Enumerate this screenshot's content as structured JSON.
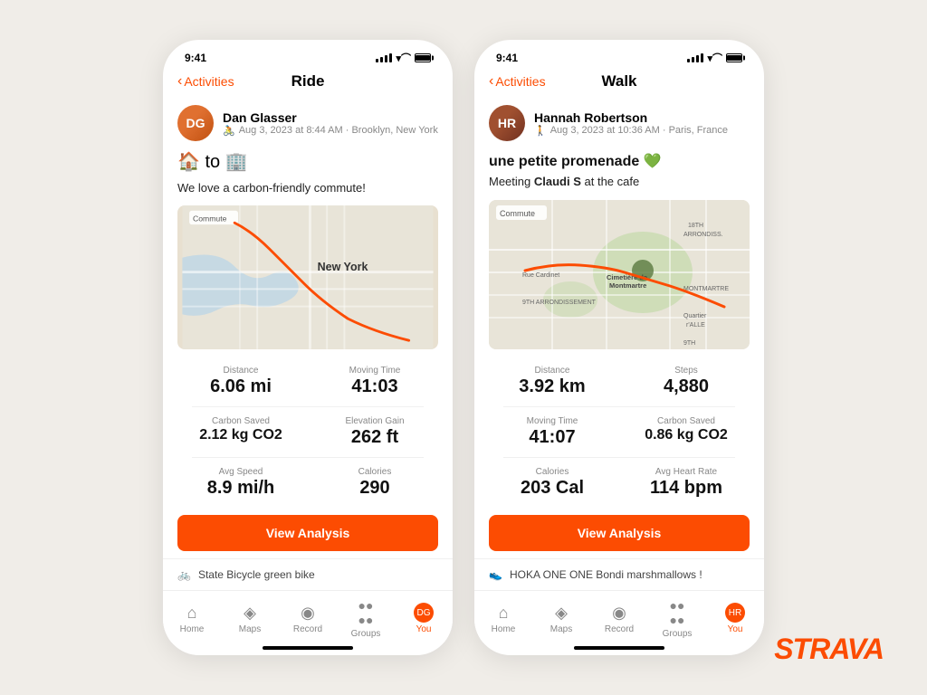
{
  "phone1": {
    "statusBar": {
      "time": "9:41",
      "battery": "full"
    },
    "nav": {
      "back": "Activities",
      "title": "Ride"
    },
    "user": {
      "name": "Dan Glasser",
      "meta": "Aug 3, 2023 at 8:44 AM · Brooklyn, New York",
      "initials": "DG"
    },
    "activity": {
      "emoji": "🏠 to 🏢",
      "description": "We love a carbon-friendly commute!"
    },
    "stats": [
      {
        "label": "Distance",
        "value": "6.06 mi"
      },
      {
        "label": "Moving Time",
        "value": "41:03"
      },
      {
        "label": "Carbon Saved",
        "value": "2.12 kg CO2"
      },
      {
        "label": "Elevation Gain",
        "value": "262 ft"
      },
      {
        "label": "Avg Speed",
        "value": "8.9 mi/h"
      },
      {
        "label": "Calories",
        "value": "290"
      }
    ],
    "viewBtn": "View Analysis",
    "equipment": "State Bicycle green bike",
    "nav_items": [
      {
        "label": "Home",
        "icon": "⌂",
        "active": false
      },
      {
        "label": "Maps",
        "icon": "🗺",
        "active": false
      },
      {
        "label": "Record",
        "icon": "⊙",
        "active": false
      },
      {
        "label": "Groups",
        "icon": "⣿",
        "active": false
      },
      {
        "label": "You",
        "icon": "●",
        "active": true
      }
    ]
  },
  "phone2": {
    "statusBar": {
      "time": "9:41"
    },
    "nav": {
      "back": "Activities",
      "title": "Walk"
    },
    "user": {
      "name": "Hannah Robertson",
      "meta": "Aug 3, 2023 at 10:36 AM · Paris, France",
      "initials": "HR"
    },
    "activity": {
      "title": "une petite promenade 💚",
      "description": "Meeting Claudi S at the cafe"
    },
    "stats": [
      {
        "label": "Distance",
        "value": "3.92 km"
      },
      {
        "label": "Steps",
        "value": "4,880"
      },
      {
        "label": "Moving Time",
        "value": "41:07"
      },
      {
        "label": "Carbon Saved",
        "value": "0.86 kg CO2"
      },
      {
        "label": "Calories",
        "value": "203 Cal"
      },
      {
        "label": "Avg Heart Rate",
        "value": "114 bpm"
      }
    ],
    "viewBtn": "View Analysis",
    "equipment": "HOKA ONE ONE Bondi marshmallows !",
    "nav_items": [
      {
        "label": "Home",
        "icon": "⌂",
        "active": false
      },
      {
        "label": "Maps",
        "icon": "🗺",
        "active": false
      },
      {
        "label": "Record",
        "icon": "⊙",
        "active": false
      },
      {
        "label": "Groups",
        "icon": "⣿",
        "active": false
      },
      {
        "label": "You",
        "icon": "●",
        "active": true
      }
    ]
  },
  "brand": "STRAVA"
}
